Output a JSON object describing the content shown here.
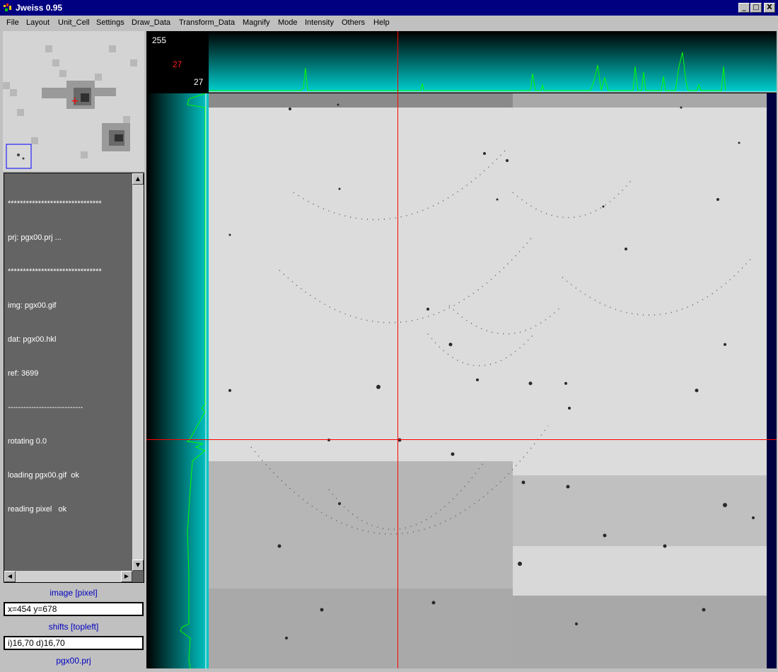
{
  "window": {
    "title": "Jweiss 0.95",
    "controls": {
      "minimize": "_",
      "maximize": "□",
      "close": "X"
    }
  },
  "menu": [
    "File",
    "Layout",
    "Unit_Cell",
    "Settings",
    "Draw_Data",
    "Transform_Data",
    "Magnify",
    "Mode",
    "Intensity",
    "Others",
    "Help"
  ],
  "histogram": {
    "max_label": "255",
    "current_value": "27",
    "min_label": "27",
    "colors": {
      "profile": "#00ff00",
      "gradient": "#00c0c0",
      "crosshair": "#ff0000"
    }
  },
  "log": {
    "lines": [
      "*******************************",
      "prj: pgx00.prj ...",
      "*******************************",
      "img: pgx00.gif",
      "dat: pgx00.hkl",
      "ref: 3699",
      "-----------------------------",
      "rotating 0.0",
      "loading pgx00.gif  ok",
      "reading pixel   ok"
    ]
  },
  "image_panel": {
    "label": "image [pixel]",
    "coords": "x=454  y=678"
  },
  "shifts_panel": {
    "label": "shifts [topleft]",
    "value": "i)16,70  d)16,70"
  },
  "project_label": "pgx00.prj"
}
